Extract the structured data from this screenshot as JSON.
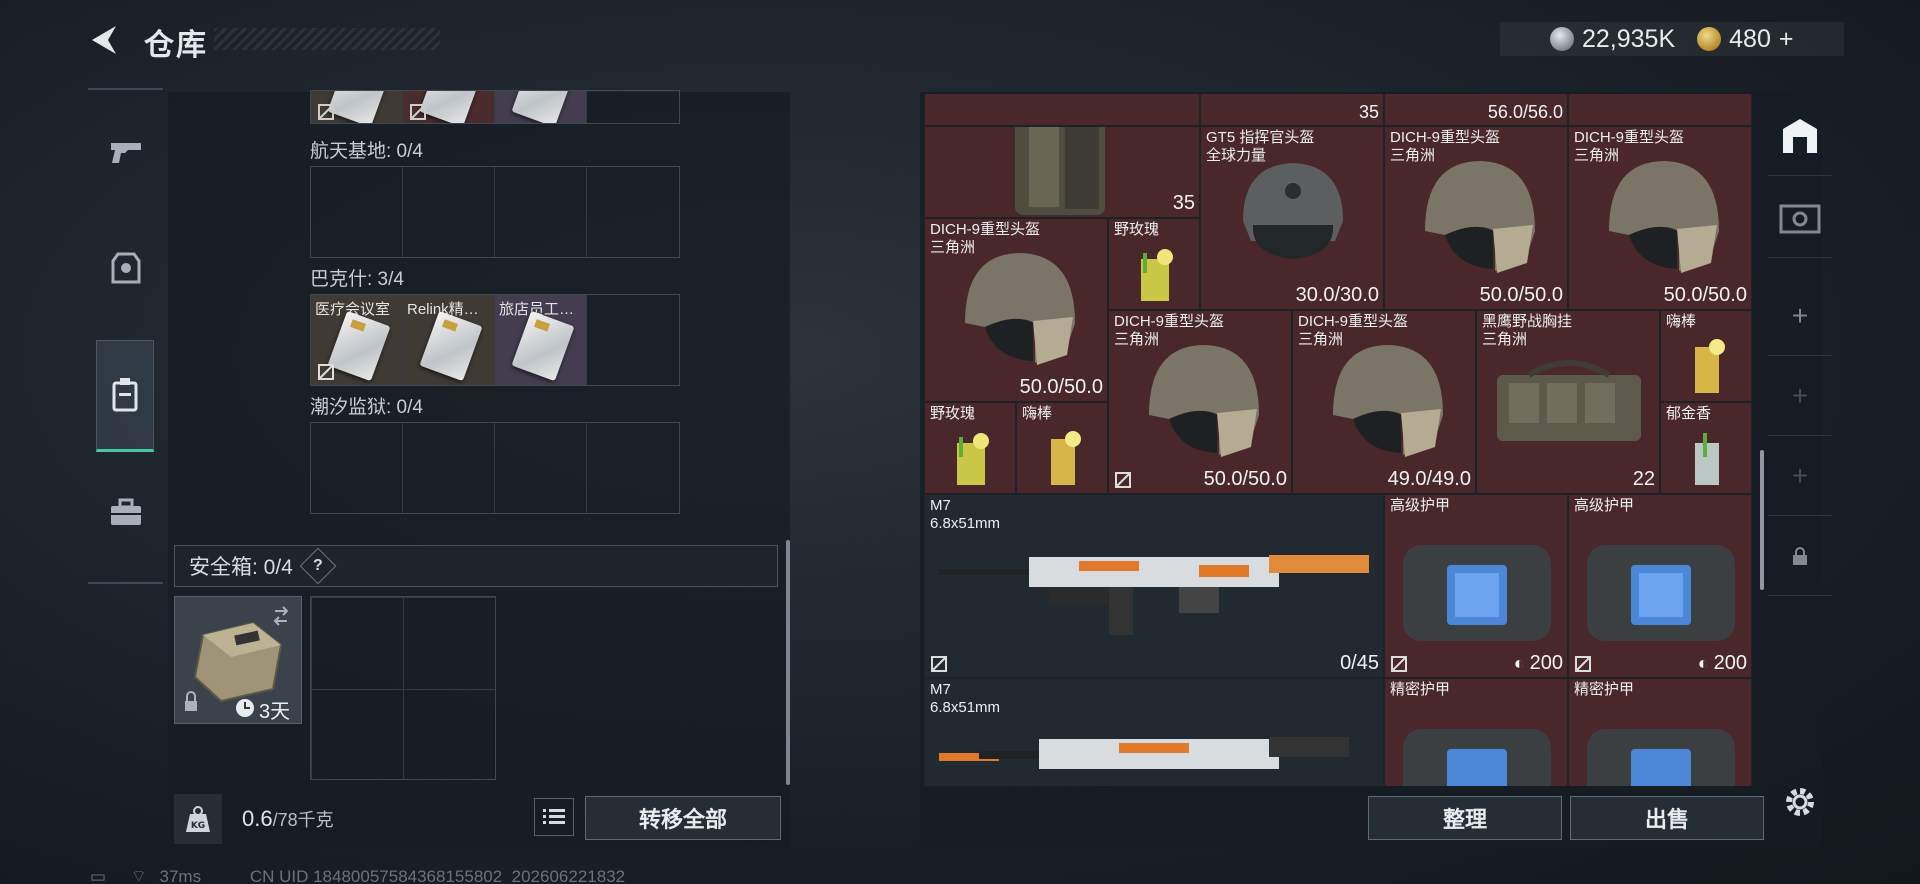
{
  "header": {
    "title": "仓库",
    "currency_silver": "22,935K",
    "currency_gold": "480",
    "plus": "+"
  },
  "left": {
    "maps": [
      {
        "label": "航天基地: 0/4"
      },
      {
        "label": "巴克什: 3/4",
        "items": [
          "医疗会议室",
          "Relink精…",
          "旅店员工…"
        ]
      },
      {
        "label": "潮汐监狱: 0/4"
      }
    ],
    "safe": {
      "label": "安全箱: 0/4",
      "help": "?",
      "duration": "3天"
    },
    "weight": {
      "value": "0.6",
      "unit": "/78千克"
    },
    "transfer_all": "转移全部"
  },
  "right": {
    "top_values": [
      "35",
      "56.0/56.0"
    ],
    "cells": [
      {
        "name": "",
        "sub": "",
        "val": "35"
      },
      {
        "name": "GT5 指挥官头盔",
        "sub": "全球力量",
        "val": "30.0/30.0"
      },
      {
        "name": "DICH-9重型头盔",
        "sub": "三角洲",
        "val": "50.0/50.0"
      },
      {
        "name": "DICH-9重型头盔",
        "sub": "三角洲",
        "val": "50.0/50.0"
      },
      {
        "name": "DICH-9重型头盔",
        "sub": "三角洲",
        "val": "50.0/50.0"
      },
      {
        "name": "野玫瑰",
        "sub": "",
        "val": ""
      },
      {
        "name": "DICH-9重型头盔",
        "sub": "三角洲",
        "val": "50.0/50.0"
      },
      {
        "name": "DICH-9重型头盔",
        "sub": "三角洲",
        "val": "49.0/49.0"
      },
      {
        "name": "黑鹰野战胸挂",
        "sub": "三角洲",
        "val": "22"
      },
      {
        "name": "嗨棒",
        "sub": "",
        "val": ""
      },
      {
        "name": "野玫瑰",
        "sub": "",
        "val": ""
      },
      {
        "name": "嗨棒",
        "sub": "",
        "val": ""
      },
      {
        "name": "郁金香",
        "sub": "",
        "val": ""
      },
      {
        "name": "M7",
        "sub": "6.8x51mm",
        "val": "0/45"
      },
      {
        "name": "高级护甲",
        "sub": "",
        "val": "200"
      },
      {
        "name": "高级护甲",
        "sub": "",
        "val": "200"
      },
      {
        "name": "M7",
        "sub": "6.8x51mm",
        "val": ""
      },
      {
        "name": "精密护甲",
        "sub": "",
        "val": ""
      },
      {
        "name": "精密护甲",
        "sub": "",
        "val": ""
      }
    ],
    "sort_button": "整理",
    "sell_button": "出售"
  },
  "status": {
    "ping": "37ms",
    "uid": "CN UID 1848005758436815580​2_202606221832"
  },
  "colors": {
    "red_cell": "#4a272b",
    "accent": "#46c6a4"
  }
}
